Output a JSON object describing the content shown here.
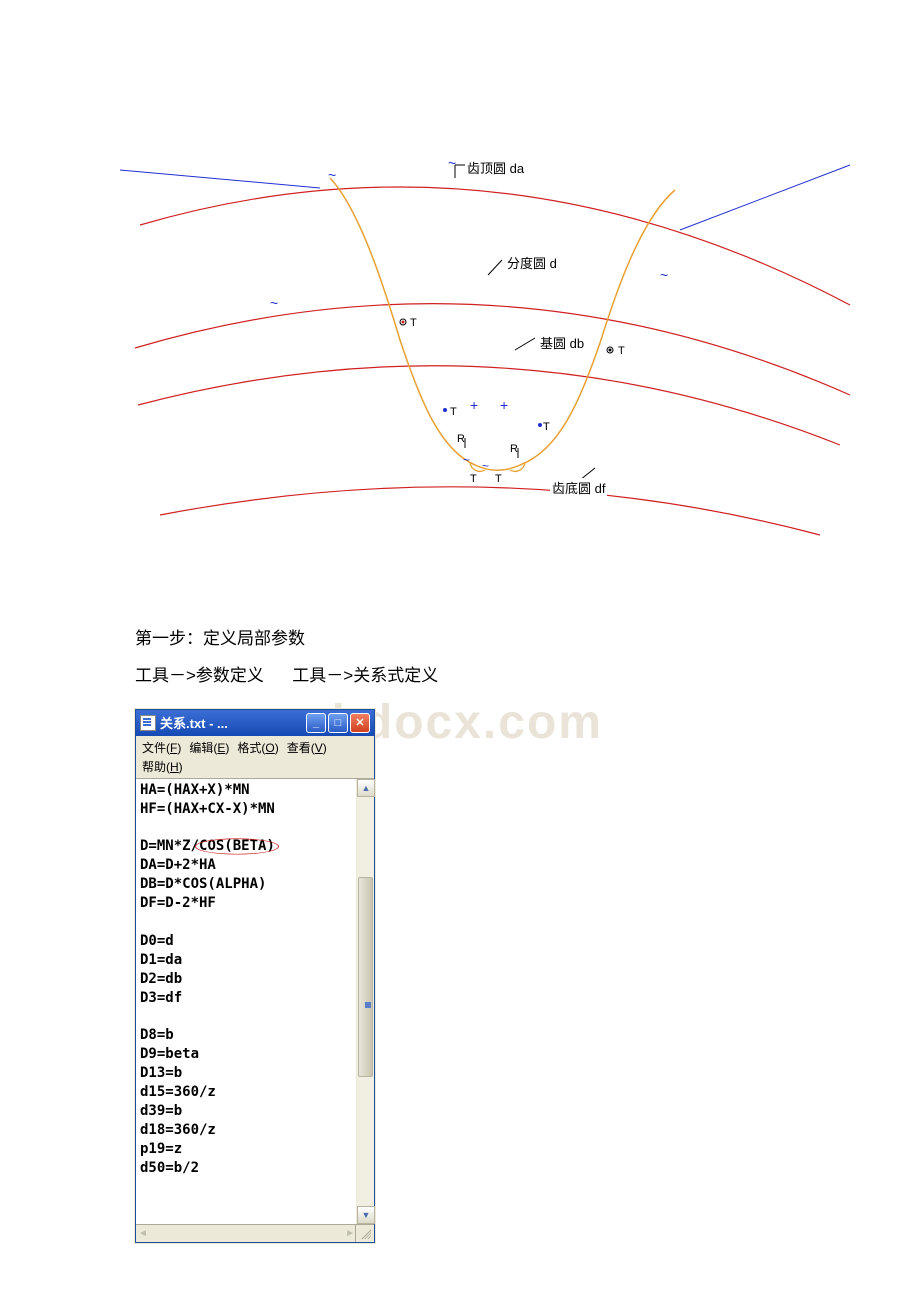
{
  "diagram": {
    "labels": {
      "da": "齿顶圆 da",
      "d": "分度圆 d",
      "db": "基圆 db",
      "df": "齿底圆 df"
    },
    "marks": {
      "T": "T",
      "R": "R"
    }
  },
  "body_text": {
    "step1": "第一步：定义局部参数",
    "tools_line_a": "工具－>参数定义",
    "tools_line_b": "工具－>关系式定义"
  },
  "watermark": "www.bdocx.com",
  "notepad": {
    "title": "关系.txt - ...",
    "menu": {
      "file": "文件(F)",
      "edit": "编辑(E)",
      "format": "格式(O)",
      "view": "查看(V)",
      "help": "帮助(H)"
    },
    "content_lines": [
      "HA=(HAX+X)*MN",
      "HF=(HAX+CX-X)*MN",
      "",
      "D=MN*Z/COS(BETA)",
      "DA=D+2*HA",
      "DB=D*COS(ALPHA)",
      "DF=D-2*HF",
      "",
      "D0=d",
      "D1=da",
      "D2=db",
      "D3=df",
      "",
      "D8=b",
      "D9=beta",
      "D13=b",
      "d15=360/z",
      "d39=b",
      "d18=360/z",
      "p19=z",
      "d50=b/2",
      ""
    ],
    "highlighted_expression_index": 3,
    "highlighted_substr": "COS(BETA)"
  }
}
